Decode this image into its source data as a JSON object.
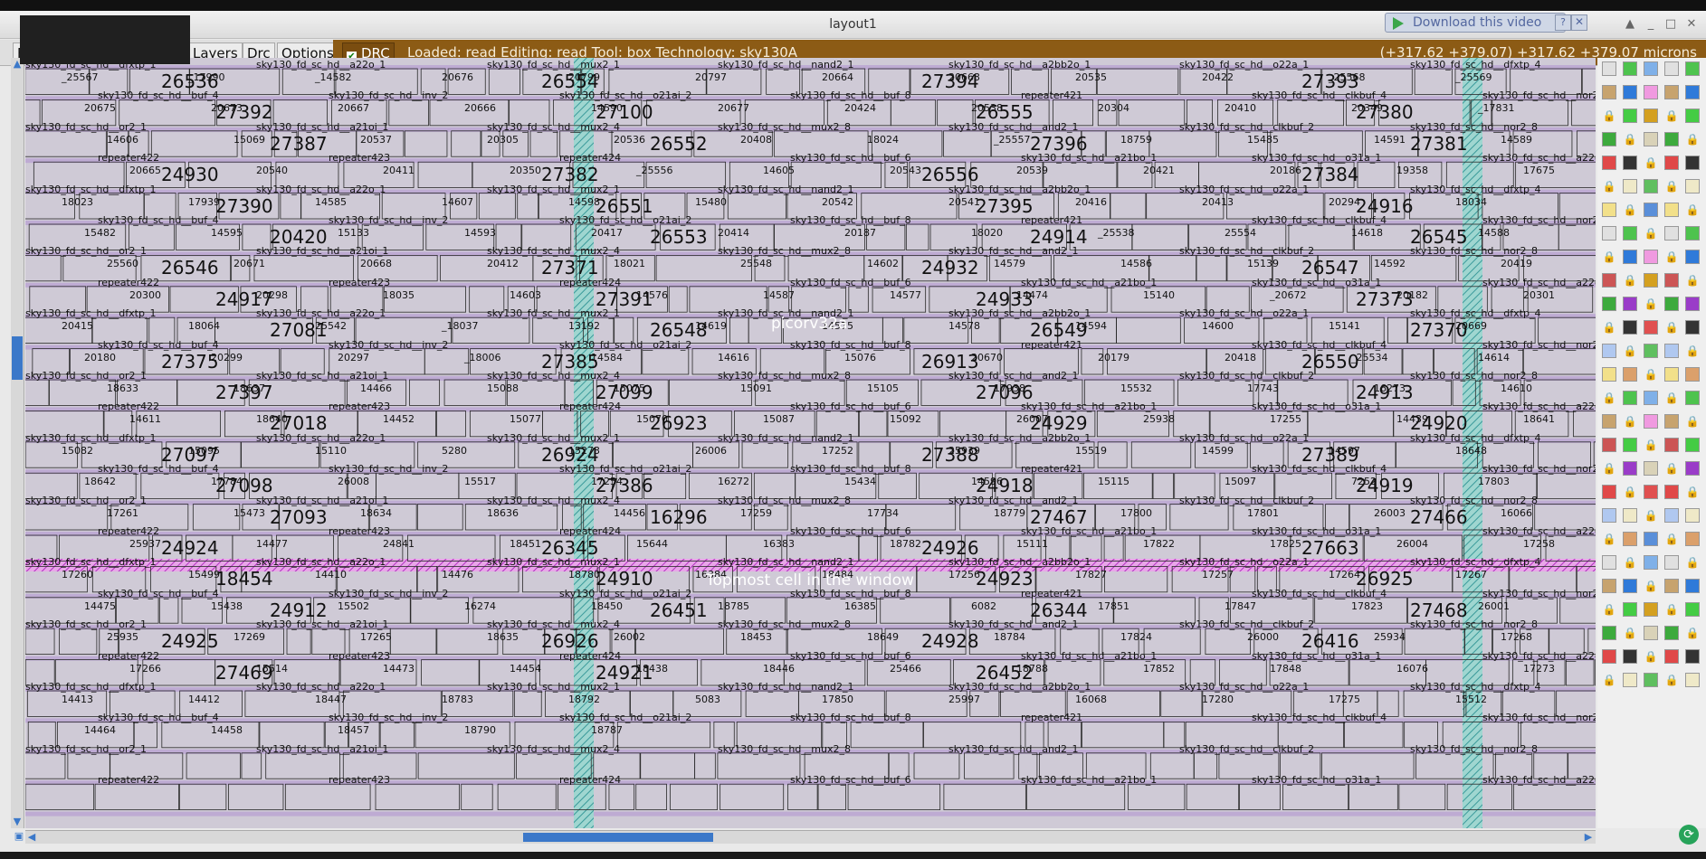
{
  "window": {
    "title": "layout1",
    "download_label": "Download this video",
    "help_glyph": "?",
    "close_glyph": "✕"
  },
  "menus": [
    {
      "label": "F"
    },
    {
      "label": "Layers"
    },
    {
      "label": "Drc"
    },
    {
      "label": "Options"
    }
  ],
  "drc_toggle": {
    "label": "DRC",
    "checked": true
  },
  "status": {
    "text": "Loaded: read  Editing: read  Tool: box   Technology: sky130A",
    "coords": "(+317.62 +379.07) +317.62 +379.07 microns"
  },
  "canvas": {
    "top_cell_label": "picorv32a",
    "hint": "Topmost cell in the window",
    "cell_numbers": [
      "26536",
      "26554",
      "27394",
      "27393",
      "27392",
      "27100",
      "26555",
      "27380",
      "27387",
      "26552",
      "27396",
      "27381",
      "24930",
      "27382",
      "26556",
      "27384",
      "27390",
      "26551",
      "27395",
      "24916",
      "20420",
      "26553",
      "24914",
      "26545",
      "26546",
      "27371",
      "24932",
      "26547",
      "24917",
      "27391",
      "24933",
      "27373",
      "27081",
      "26548",
      "26549",
      "27370",
      "27375",
      "27385",
      "26913",
      "26550",
      "27397",
      "27099",
      "27096",
      "24913",
      "27018",
      "26923",
      "24929",
      "24920",
      "27097",
      "26924",
      "27388",
      "27389",
      "27098",
      "27386",
      "24918",
      "24919",
      "27093",
      "16296",
      "27467",
      "27466",
      "24924",
      "26345",
      "24926",
      "27663",
      "18454",
      "24910",
      "24923",
      "26925",
      "24912",
      "26451",
      "26344",
      "27468",
      "24925",
      "26926",
      "24928",
      "26416",
      "27469",
      "24921",
      "26452"
    ],
    "cell_labels": [
      "sky130_fd_sc_hd__dfxtp_1",
      "sky130_fd_sc_hd__a22o_1",
      "sky130_fd_sc_hd__mux2_1",
      "sky130_fd_sc_hd__nand2_1",
      "sky130_fd_sc_hd__a2bb2o_1",
      "sky130_fd_sc_hd__o22a_1",
      "sky130_fd_sc_hd__dfxtp_4",
      "sky130_fd_sc_hd__buf_4",
      "sky130_fd_sc_hd__inv_2",
      "sky130_fd_sc_hd__o21ai_2",
      "sky130_fd_sc_hd__buf_8",
      "repeater421",
      "sky130_fd_sc_hd__clkbuf_4",
      "sky130_fd_sc_hd__nor2_1",
      "sky130_fd_sc_hd__or2_1",
      "sky130_fd_sc_hd__a21oi_1",
      "sky130_fd_sc_hd__mux2_4",
      "sky130_fd_sc_hd__mux2_8",
      "sky130_fd_sc_hd__and2_1",
      "sky130_fd_sc_hd__clkbuf_2",
      "sky130_fd_sc_hd__nor2_8",
      "repeater422",
      "repeater423",
      "repeater424",
      "sky130_fd_sc_hd__buf_6",
      "sky130_fd_sc_hd__a21bo_1",
      "sky130_fd_sc_hd__o31a_1",
      "sky130_fd_sc_hd__a22oi_1"
    ],
    "small_ids": [
      "_25567",
      "_17990",
      "_14582",
      "20676",
      "20799",
      "20797",
      "20664",
      "20663",
      "20535",
      "20422",
      "_25568",
      "_25569",
      "20675",
      "20673",
      "20667",
      "20666",
      "14590",
      "20677",
      "20424",
      "20538",
      "20304",
      "20410",
      "20349",
      "_17831",
      "14606",
      "15069",
      "20537",
      "20305",
      "20536",
      "20408",
      "18024",
      "_25557",
      "18759",
      "15485",
      "14591",
      "14589",
      "20665",
      "20540",
      "20411",
      "20350",
      "_25556",
      "14605",
      "20543",
      "20539",
      "20421",
      "20186",
      "19358",
      "17675",
      "18023",
      "17939",
      "14585",
      "14607",
      "14598",
      "15480",
      "20542",
      "20541",
      "20416",
      "20413",
      "20294",
      "18034",
      "15482",
      "14595",
      "15133",
      "14593",
      "20417",
      "20414",
      "20187",
      "18020",
      "_25538",
      "25554",
      "14618",
      "14588",
      "25560",
      "20671",
      "20668",
      "20412",
      "18021",
      "25548",
      "14602",
      "14579",
      "14586",
      "15139",
      "14592",
      "20419",
      "20300",
      "20298",
      "18035",
      "14603",
      "14576",
      "14587",
      "14577",
      "14474",
      "15140",
      "_20672",
      "20182",
      "20301",
      "20415",
      "18064",
      "25542",
      "_18037",
      "13192",
      "14619",
      "14575",
      "14578",
      "14594",
      "14600",
      "15141",
      "20669",
      "20180",
      "20299",
      "20297",
      "_18006",
      "14584",
      "14616",
      "15076",
      "20670",
      "20179",
      "20418",
      "_25534",
      "14614",
      "18633",
      "18637",
      "14466",
      "15088",
      "15075",
      "15091",
      "15105",
      "17938",
      "15532",
      "17743",
      "16273",
      "14610",
      "14611",
      "18640",
      "14452",
      "15077",
      "15070",
      "15087",
      "15092",
      "26007",
      "25938",
      "17255",
      "14439",
      "18641",
      "15082",
      "15095",
      "15110",
      "5280",
      "15273",
      "26006",
      "17252",
      "25939",
      "15519",
      "14599",
      "14597",
      "18648",
      "18642",
      "17784",
      "26008",
      "15517",
      "17254",
      "16272",
      "15434",
      "14596",
      "15115",
      "15097",
      "7252",
      "17803",
      "17261",
      "15473",
      "18634",
      "18636",
      "14456",
      "17259",
      "17734",
      "18779",
      "17800",
      "17801",
      "26003",
      "16066",
      "25937",
      "14477",
      "24841",
      "18451",
      "15644",
      "16383",
      "18782",
      "15111",
      "17822",
      "17825",
      "26004",
      "17258",
      "17260",
      "15499",
      "14410",
      "14476",
      "18780",
      "16384",
      "18484",
      "17256",
      "17827",
      "17257",
      "17264",
      "17267",
      "14475",
      "15438",
      "15502",
      "16274",
      "18450",
      "18785",
      "16385",
      "6082",
      "17851",
      "17847",
      "17823",
      "26001",
      "25935",
      "17269",
      "17265",
      "18635",
      "26002",
      "18453",
      "18649",
      "18784",
      "17824",
      "26000",
      "25934",
      "17268",
      "17266",
      "15514",
      "14473",
      "14454",
      "18438",
      "18446",
      "25466",
      "18788",
      "17852",
      "17848",
      "16076",
      "17273",
      "14413",
      "14412",
      "18447",
      "18783",
      "18792",
      "5083",
      "17850",
      "25997",
      "16068",
      "17280",
      "17275",
      "15512",
      "14464",
      "14458",
      "18457",
      "18790",
      "18787"
    ]
  }
}
